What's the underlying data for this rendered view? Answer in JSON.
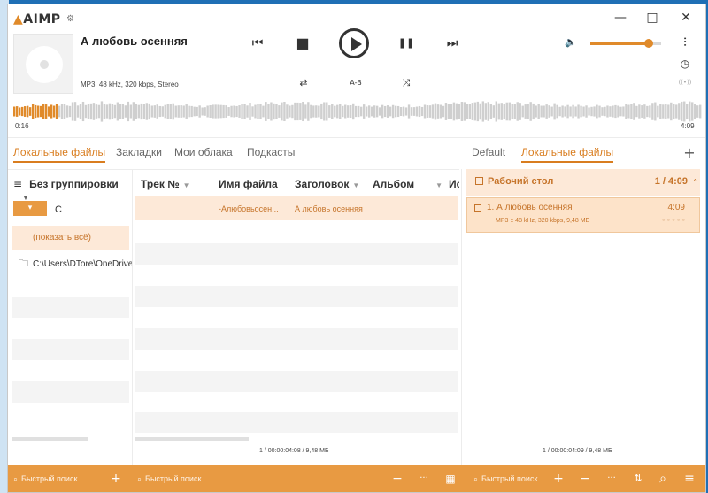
{
  "app": {
    "logo": "AIMP"
  },
  "window": {
    "minimize": "—",
    "maximize": "□",
    "close": "✕"
  },
  "player": {
    "track_title": "А любовь осенняя",
    "track_info": "MP3, 48 kHz, 320 kbps, Stereo",
    "ab_label": "A-B",
    "time_elapsed": "0:16",
    "time_total": "4:09",
    "progress_fraction": 0.065,
    "volume_fraction": 0.82
  },
  "tabs_left": [
    "Локальные файлы",
    "Закладки",
    "Мои облака",
    "Подкасты"
  ],
  "tabs_right": [
    "Default",
    "Локальные файлы"
  ],
  "grouping": {
    "label": "Без группировки",
    "chip_label": "▾",
    "drive": "C",
    "show_all": "(показать всё)",
    "folder": "C:\\Users\\DTore\\OneDrive"
  },
  "table": {
    "columns": [
      "Трек №",
      "Имя файла",
      "Заголовок",
      "Альбом",
      "Ис"
    ],
    "rows": [
      {
        "track": "",
        "filename": "-Алюбовьосен...",
        "title": "А любовь осенняя",
        "album": ""
      }
    ]
  },
  "playlist": {
    "name": "Рабочий стол",
    "summary": "1 / 4:09",
    "items": [
      {
        "name": "1. А любовь осенняя",
        "duration": "4:09",
        "meta": "MP3 :: 48 kHz, 320 kbps, 9,48 МБ",
        "rating": "○○○○○"
      }
    ]
  },
  "status": {
    "left": "1 / 00:00:04:08 / 9,48 МБ",
    "right": "1 / 00:00:04:09 / 9,48 МБ"
  },
  "search": {
    "placeholder_1": "Быстрый поиск",
    "placeholder_2": "Быстрый поиск",
    "placeholder_3": "Быстрый поиск"
  },
  "icons": {
    "prev": "⏮",
    "stop": "■",
    "pause": "❚❚",
    "next": "⏭",
    "repeat": "⇄",
    "shuffle": "⤨",
    "volume": "🔈",
    "equalizer": "⫶",
    "clock": "◷",
    "broadcast": "((•))",
    "add": "+",
    "more": "···",
    "remove": "−",
    "grid": "▦",
    "search": "⌕",
    "menu": "≡",
    "folder": "🗀"
  },
  "colors": {
    "accent": "#e08a2a",
    "accent_light": "#fde9d8",
    "bar": "#e89a42"
  }
}
